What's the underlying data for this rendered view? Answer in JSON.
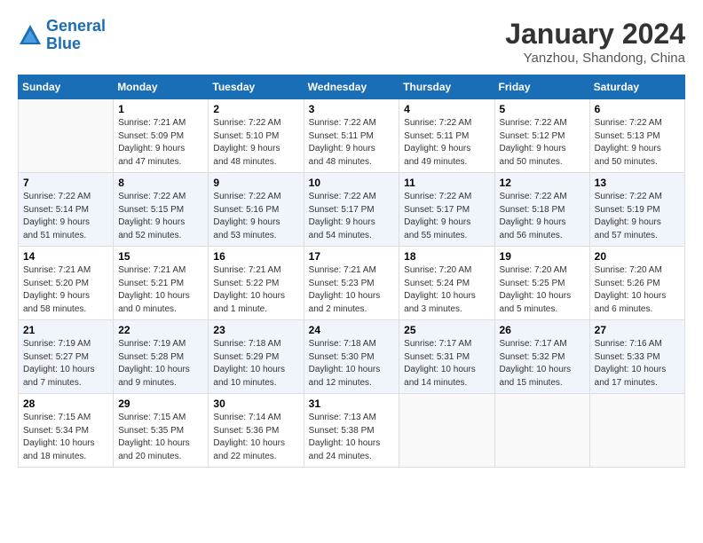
{
  "header": {
    "logo_line1": "General",
    "logo_line2": "Blue",
    "month_title": "January 2024",
    "location": "Yanzhou, Shandong, China"
  },
  "days_of_week": [
    "Sunday",
    "Monday",
    "Tuesday",
    "Wednesday",
    "Thursday",
    "Friday",
    "Saturday"
  ],
  "weeks": [
    [
      {
        "num": "",
        "info": ""
      },
      {
        "num": "1",
        "info": "Sunrise: 7:21 AM\nSunset: 5:09 PM\nDaylight: 9 hours\nand 47 minutes."
      },
      {
        "num": "2",
        "info": "Sunrise: 7:22 AM\nSunset: 5:10 PM\nDaylight: 9 hours\nand 48 minutes."
      },
      {
        "num": "3",
        "info": "Sunrise: 7:22 AM\nSunset: 5:11 PM\nDaylight: 9 hours\nand 48 minutes."
      },
      {
        "num": "4",
        "info": "Sunrise: 7:22 AM\nSunset: 5:11 PM\nDaylight: 9 hours\nand 49 minutes."
      },
      {
        "num": "5",
        "info": "Sunrise: 7:22 AM\nSunset: 5:12 PM\nDaylight: 9 hours\nand 50 minutes."
      },
      {
        "num": "6",
        "info": "Sunrise: 7:22 AM\nSunset: 5:13 PM\nDaylight: 9 hours\nand 50 minutes."
      }
    ],
    [
      {
        "num": "7",
        "info": "Sunrise: 7:22 AM\nSunset: 5:14 PM\nDaylight: 9 hours\nand 51 minutes."
      },
      {
        "num": "8",
        "info": "Sunrise: 7:22 AM\nSunset: 5:15 PM\nDaylight: 9 hours\nand 52 minutes."
      },
      {
        "num": "9",
        "info": "Sunrise: 7:22 AM\nSunset: 5:16 PM\nDaylight: 9 hours\nand 53 minutes."
      },
      {
        "num": "10",
        "info": "Sunrise: 7:22 AM\nSunset: 5:17 PM\nDaylight: 9 hours\nand 54 minutes."
      },
      {
        "num": "11",
        "info": "Sunrise: 7:22 AM\nSunset: 5:17 PM\nDaylight: 9 hours\nand 55 minutes."
      },
      {
        "num": "12",
        "info": "Sunrise: 7:22 AM\nSunset: 5:18 PM\nDaylight: 9 hours\nand 56 minutes."
      },
      {
        "num": "13",
        "info": "Sunrise: 7:22 AM\nSunset: 5:19 PM\nDaylight: 9 hours\nand 57 minutes."
      }
    ],
    [
      {
        "num": "14",
        "info": "Sunrise: 7:21 AM\nSunset: 5:20 PM\nDaylight: 9 hours\nand 58 minutes."
      },
      {
        "num": "15",
        "info": "Sunrise: 7:21 AM\nSunset: 5:21 PM\nDaylight: 10 hours\nand 0 minutes."
      },
      {
        "num": "16",
        "info": "Sunrise: 7:21 AM\nSunset: 5:22 PM\nDaylight: 10 hours\nand 1 minute."
      },
      {
        "num": "17",
        "info": "Sunrise: 7:21 AM\nSunset: 5:23 PM\nDaylight: 10 hours\nand 2 minutes."
      },
      {
        "num": "18",
        "info": "Sunrise: 7:20 AM\nSunset: 5:24 PM\nDaylight: 10 hours\nand 3 minutes."
      },
      {
        "num": "19",
        "info": "Sunrise: 7:20 AM\nSunset: 5:25 PM\nDaylight: 10 hours\nand 5 minutes."
      },
      {
        "num": "20",
        "info": "Sunrise: 7:20 AM\nSunset: 5:26 PM\nDaylight: 10 hours\nand 6 minutes."
      }
    ],
    [
      {
        "num": "21",
        "info": "Sunrise: 7:19 AM\nSunset: 5:27 PM\nDaylight: 10 hours\nand 7 minutes."
      },
      {
        "num": "22",
        "info": "Sunrise: 7:19 AM\nSunset: 5:28 PM\nDaylight: 10 hours\nand 9 minutes."
      },
      {
        "num": "23",
        "info": "Sunrise: 7:18 AM\nSunset: 5:29 PM\nDaylight: 10 hours\nand 10 minutes."
      },
      {
        "num": "24",
        "info": "Sunrise: 7:18 AM\nSunset: 5:30 PM\nDaylight: 10 hours\nand 12 minutes."
      },
      {
        "num": "25",
        "info": "Sunrise: 7:17 AM\nSunset: 5:31 PM\nDaylight: 10 hours\nand 14 minutes."
      },
      {
        "num": "26",
        "info": "Sunrise: 7:17 AM\nSunset: 5:32 PM\nDaylight: 10 hours\nand 15 minutes."
      },
      {
        "num": "27",
        "info": "Sunrise: 7:16 AM\nSunset: 5:33 PM\nDaylight: 10 hours\nand 17 minutes."
      }
    ],
    [
      {
        "num": "28",
        "info": "Sunrise: 7:15 AM\nSunset: 5:34 PM\nDaylight: 10 hours\nand 18 minutes."
      },
      {
        "num": "29",
        "info": "Sunrise: 7:15 AM\nSunset: 5:35 PM\nDaylight: 10 hours\nand 20 minutes."
      },
      {
        "num": "30",
        "info": "Sunrise: 7:14 AM\nSunset: 5:36 PM\nDaylight: 10 hours\nand 22 minutes."
      },
      {
        "num": "31",
        "info": "Sunrise: 7:13 AM\nSunset: 5:38 PM\nDaylight: 10 hours\nand 24 minutes."
      },
      {
        "num": "",
        "info": ""
      },
      {
        "num": "",
        "info": ""
      },
      {
        "num": "",
        "info": ""
      }
    ]
  ]
}
